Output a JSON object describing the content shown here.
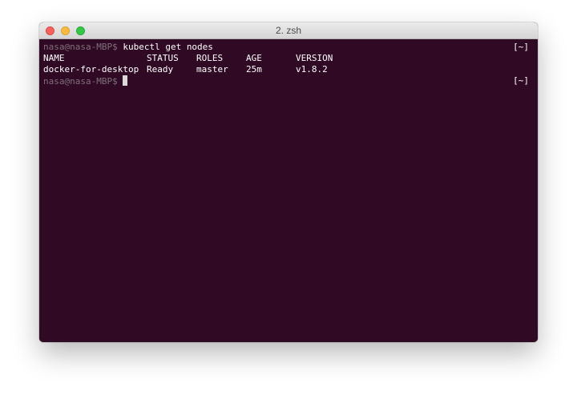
{
  "window": {
    "title": "2. zsh"
  },
  "terminal": {
    "prompt": "nasa@nasa-MBP$",
    "command": "kubectl get nodes",
    "right_prompt": "[~]",
    "table": {
      "headers": [
        "NAME",
        "STATUS",
        "ROLES",
        "AGE",
        "VERSION"
      ],
      "rows": [
        [
          "docker-for-desktop",
          "Ready",
          "master",
          "25m",
          "v1.8.2"
        ]
      ]
    }
  },
  "colors": {
    "terminal_bg": "#300a24",
    "prompt_text": "#7f6f7a",
    "text": "#ffffff",
    "close": "#fc615d",
    "minimize": "#fdbc40",
    "maximize": "#34c84a"
  }
}
